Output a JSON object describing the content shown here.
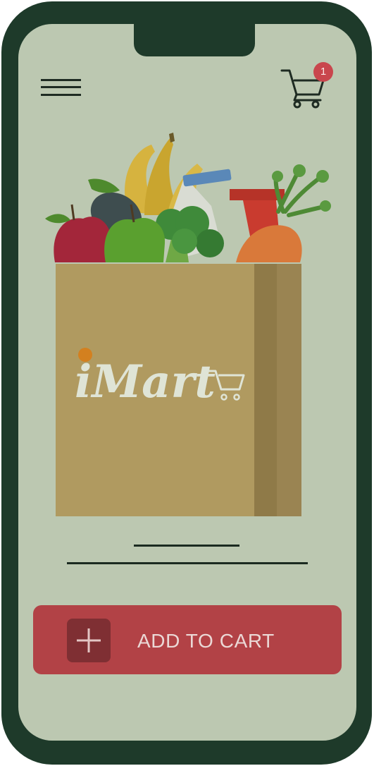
{
  "header": {
    "menu_icon": "hamburger-icon",
    "cart_icon": "shopping-cart-icon",
    "cart_badge_count": "1"
  },
  "hero": {
    "brand_name": "iMart",
    "image_icon": "grocery-bag-illustration"
  },
  "cta": {
    "label": "ADD TO CART",
    "icon": "plus-icon"
  },
  "colors": {
    "frame": "#1e3a2a",
    "screen_bg": "#bcc8b1",
    "accent": "#b24246",
    "accent_dark": "#7f2f33",
    "badge": "#c9464d",
    "bag": "#b09a60"
  }
}
